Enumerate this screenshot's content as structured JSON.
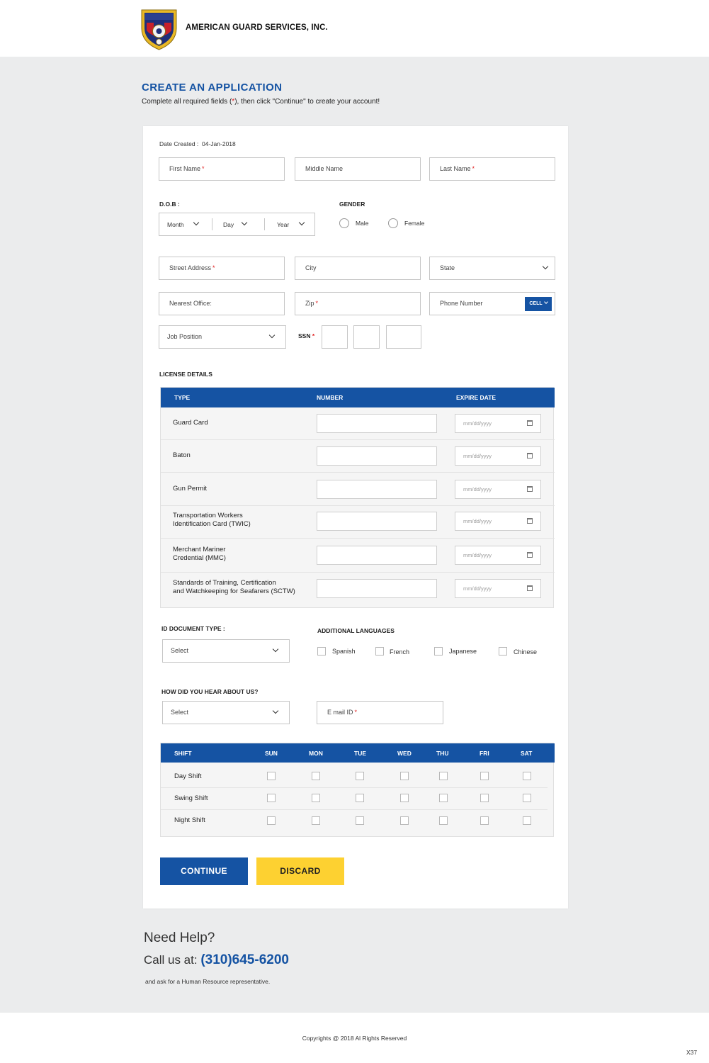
{
  "header": {
    "brand": "AMERICAN GUARD SERVICES, INC."
  },
  "page": {
    "title": "CREATE AN APPLICATION",
    "subtitle_pre": "Complete all required fields (",
    "subtitle_star": "*",
    "subtitle_post": "), then click \"Continue\" to create your account!"
  },
  "form": {
    "date_label": "Date Created :",
    "date_value": "04-Jan-2018",
    "first_name": "First Name",
    "middle_name": "Middle Name",
    "last_name": "Last Name",
    "required_star": "*",
    "dob_label": "D.O.B :",
    "dob_month": "Month",
    "dob_day": "Day",
    "dob_year": "Year",
    "gender_label": "GENDER",
    "gender_male": "Male",
    "gender_female": "Female",
    "street": "Street Address",
    "city": "City",
    "state": "State",
    "nearest_office": "Nearest Office:",
    "zip": "Zip",
    "phone": "Phone Number",
    "cell_btn": "CELL",
    "job_position": "Job Position",
    "ssn_label": "SSN",
    "license_heading": "LICENSE DETAILS",
    "license_cols": [
      "TYPE",
      "NUMBER",
      "EXPIRE DATE"
    ],
    "license_rows": [
      {
        "line1": "Guard Card",
        "line2": ""
      },
      {
        "line1": "Baton",
        "line2": ""
      },
      {
        "line1": "Gun Permit",
        "line2": ""
      },
      {
        "line1": "Transportation Workers",
        "line2": "Identification Card (TWIC)"
      },
      {
        "line1": "Merchant Mariner",
        "line2": "Credential (MMC)"
      },
      {
        "line1": "Standards of Training, Certification",
        "line2": "and Watchkeeping for Seafarers (SCTW)"
      }
    ],
    "date_placeholder": "mm/dd/yyyy",
    "id_doc_label": "ID DOCUMENT TYPE :",
    "id_doc_select": "Select",
    "languages_label": "ADDITIONAL LANGUAGES",
    "languages": [
      "Spanish",
      "French",
      "Japanese",
      "Chinese"
    ],
    "hear_label": "HOW DID YOU HEAR ABOUT US?",
    "hear_select": "Select",
    "email": "E mail ID",
    "shift_cols": [
      "SHIFT",
      "SUN",
      "MON",
      "TUE",
      "WED",
      "THU",
      "FRI",
      "SAT"
    ],
    "shift_rows": [
      "Day Shift",
      "Swing Shift",
      "Night Shift"
    ],
    "continue_btn": "CONTINUE",
    "discard_btn": "DISCARD"
  },
  "help": {
    "heading": "Need Help?",
    "call_prefix": "Call us at: ",
    "phone": "(310)645-6200",
    "note": "and ask for a Human Resource representative."
  },
  "footer": {
    "copyright": "Copyrights @ 2018 Al Rights Reserved",
    "code": "X37"
  },
  "colors": {
    "primary": "#1553a3",
    "accent": "#fdd131",
    "required": "#e02020",
    "background": "#ebeced"
  }
}
